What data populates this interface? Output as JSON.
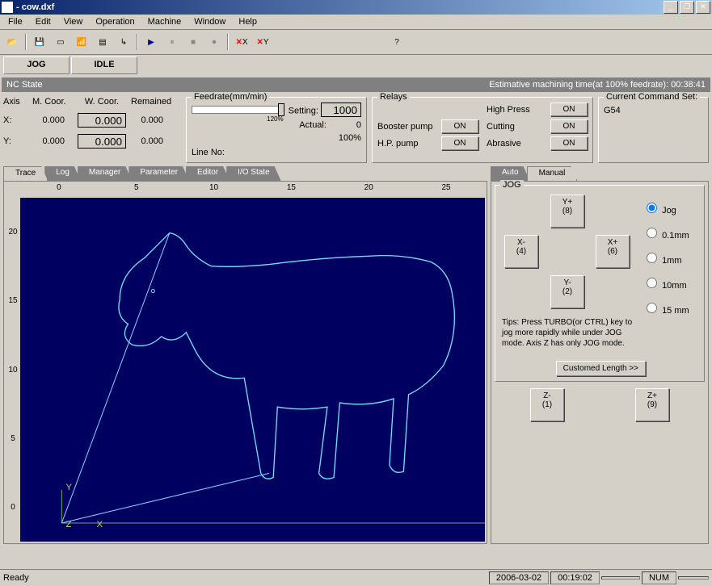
{
  "window": {
    "title": " - cow.dxf"
  },
  "menu": [
    "File",
    "Edit",
    "View",
    "Operation",
    "Machine",
    "Window",
    "Help"
  ],
  "status_tabs": {
    "jog": "JOG",
    "idle": "IDLE"
  },
  "ncbar": {
    "left": "NC State",
    "right": "Estimative machining time(at 100% feedrate): 00:38:41"
  },
  "axis": {
    "headers": {
      "axis": "Axis",
      "mcoor": "M. Coor.",
      "wcoor": "W. Coor.",
      "remained": "Remained"
    },
    "rows": [
      {
        "name": "X:",
        "m": "0.000",
        "w": "0.000",
        "r": "0.000"
      },
      {
        "name": "Y:",
        "m": "0.000",
        "w": "0.000",
        "r": "0.000"
      }
    ]
  },
  "feedrate": {
    "title": "Feedrate(mm/min)",
    "setting_label": "Setting:",
    "setting_value": "1000",
    "actual_label": "Actual:",
    "actual_value": "0",
    "percent": "100%",
    "slider_max": "120%",
    "lineno_label": "Line No:"
  },
  "relays": {
    "title": "Relays",
    "items": [
      {
        "label": "Booster pump",
        "btn": "ON"
      },
      {
        "label": "H.P. pump",
        "btn": "ON"
      },
      {
        "label": "High Press",
        "btn": "ON"
      },
      {
        "label": "Cutting",
        "btn": "ON"
      },
      {
        "label": "Abrasive",
        "btn": "ON"
      }
    ]
  },
  "cmdset": {
    "title": "Current Command Set:",
    "value": "G54"
  },
  "left_tabs": [
    "Trace",
    "Log",
    "Manager",
    "Parameter",
    "Editor",
    "I/O State"
  ],
  "ruler_h": [
    "0",
    "5",
    "10",
    "15",
    "20",
    "25"
  ],
  "ruler_v": [
    "20",
    "15",
    "10",
    "5",
    "0"
  ],
  "axes_labels": {
    "x": "X",
    "y": "Y",
    "z": "Z"
  },
  "right_tabs": {
    "auto": "Auto",
    "manual": "Manual"
  },
  "jog": {
    "title": "JOG",
    "buttons": {
      "yp": "Y+\n(8)",
      "ym": "Y-\n(2)",
      "xp": "X+\n(6)",
      "xm": "X-\n(4)",
      "zp": "Z+\n(9)",
      "zm": "Z-\n(1)"
    },
    "opts": [
      "Jog",
      "0.1mm",
      "1mm",
      "10mm",
      "15  mm"
    ],
    "tips": "Tips: Press TURBO(or CTRL) key to jog more rapidly while under JOG mode. Axis Z has only JOG mode.",
    "cust": "Customed Length  >>"
  },
  "statusbar": {
    "ready": "Ready",
    "date": "2006-03-02",
    "time": "00:19:02",
    "num": "NUM"
  },
  "toolbar_xy": {
    "x": "X",
    "y": "Y"
  }
}
